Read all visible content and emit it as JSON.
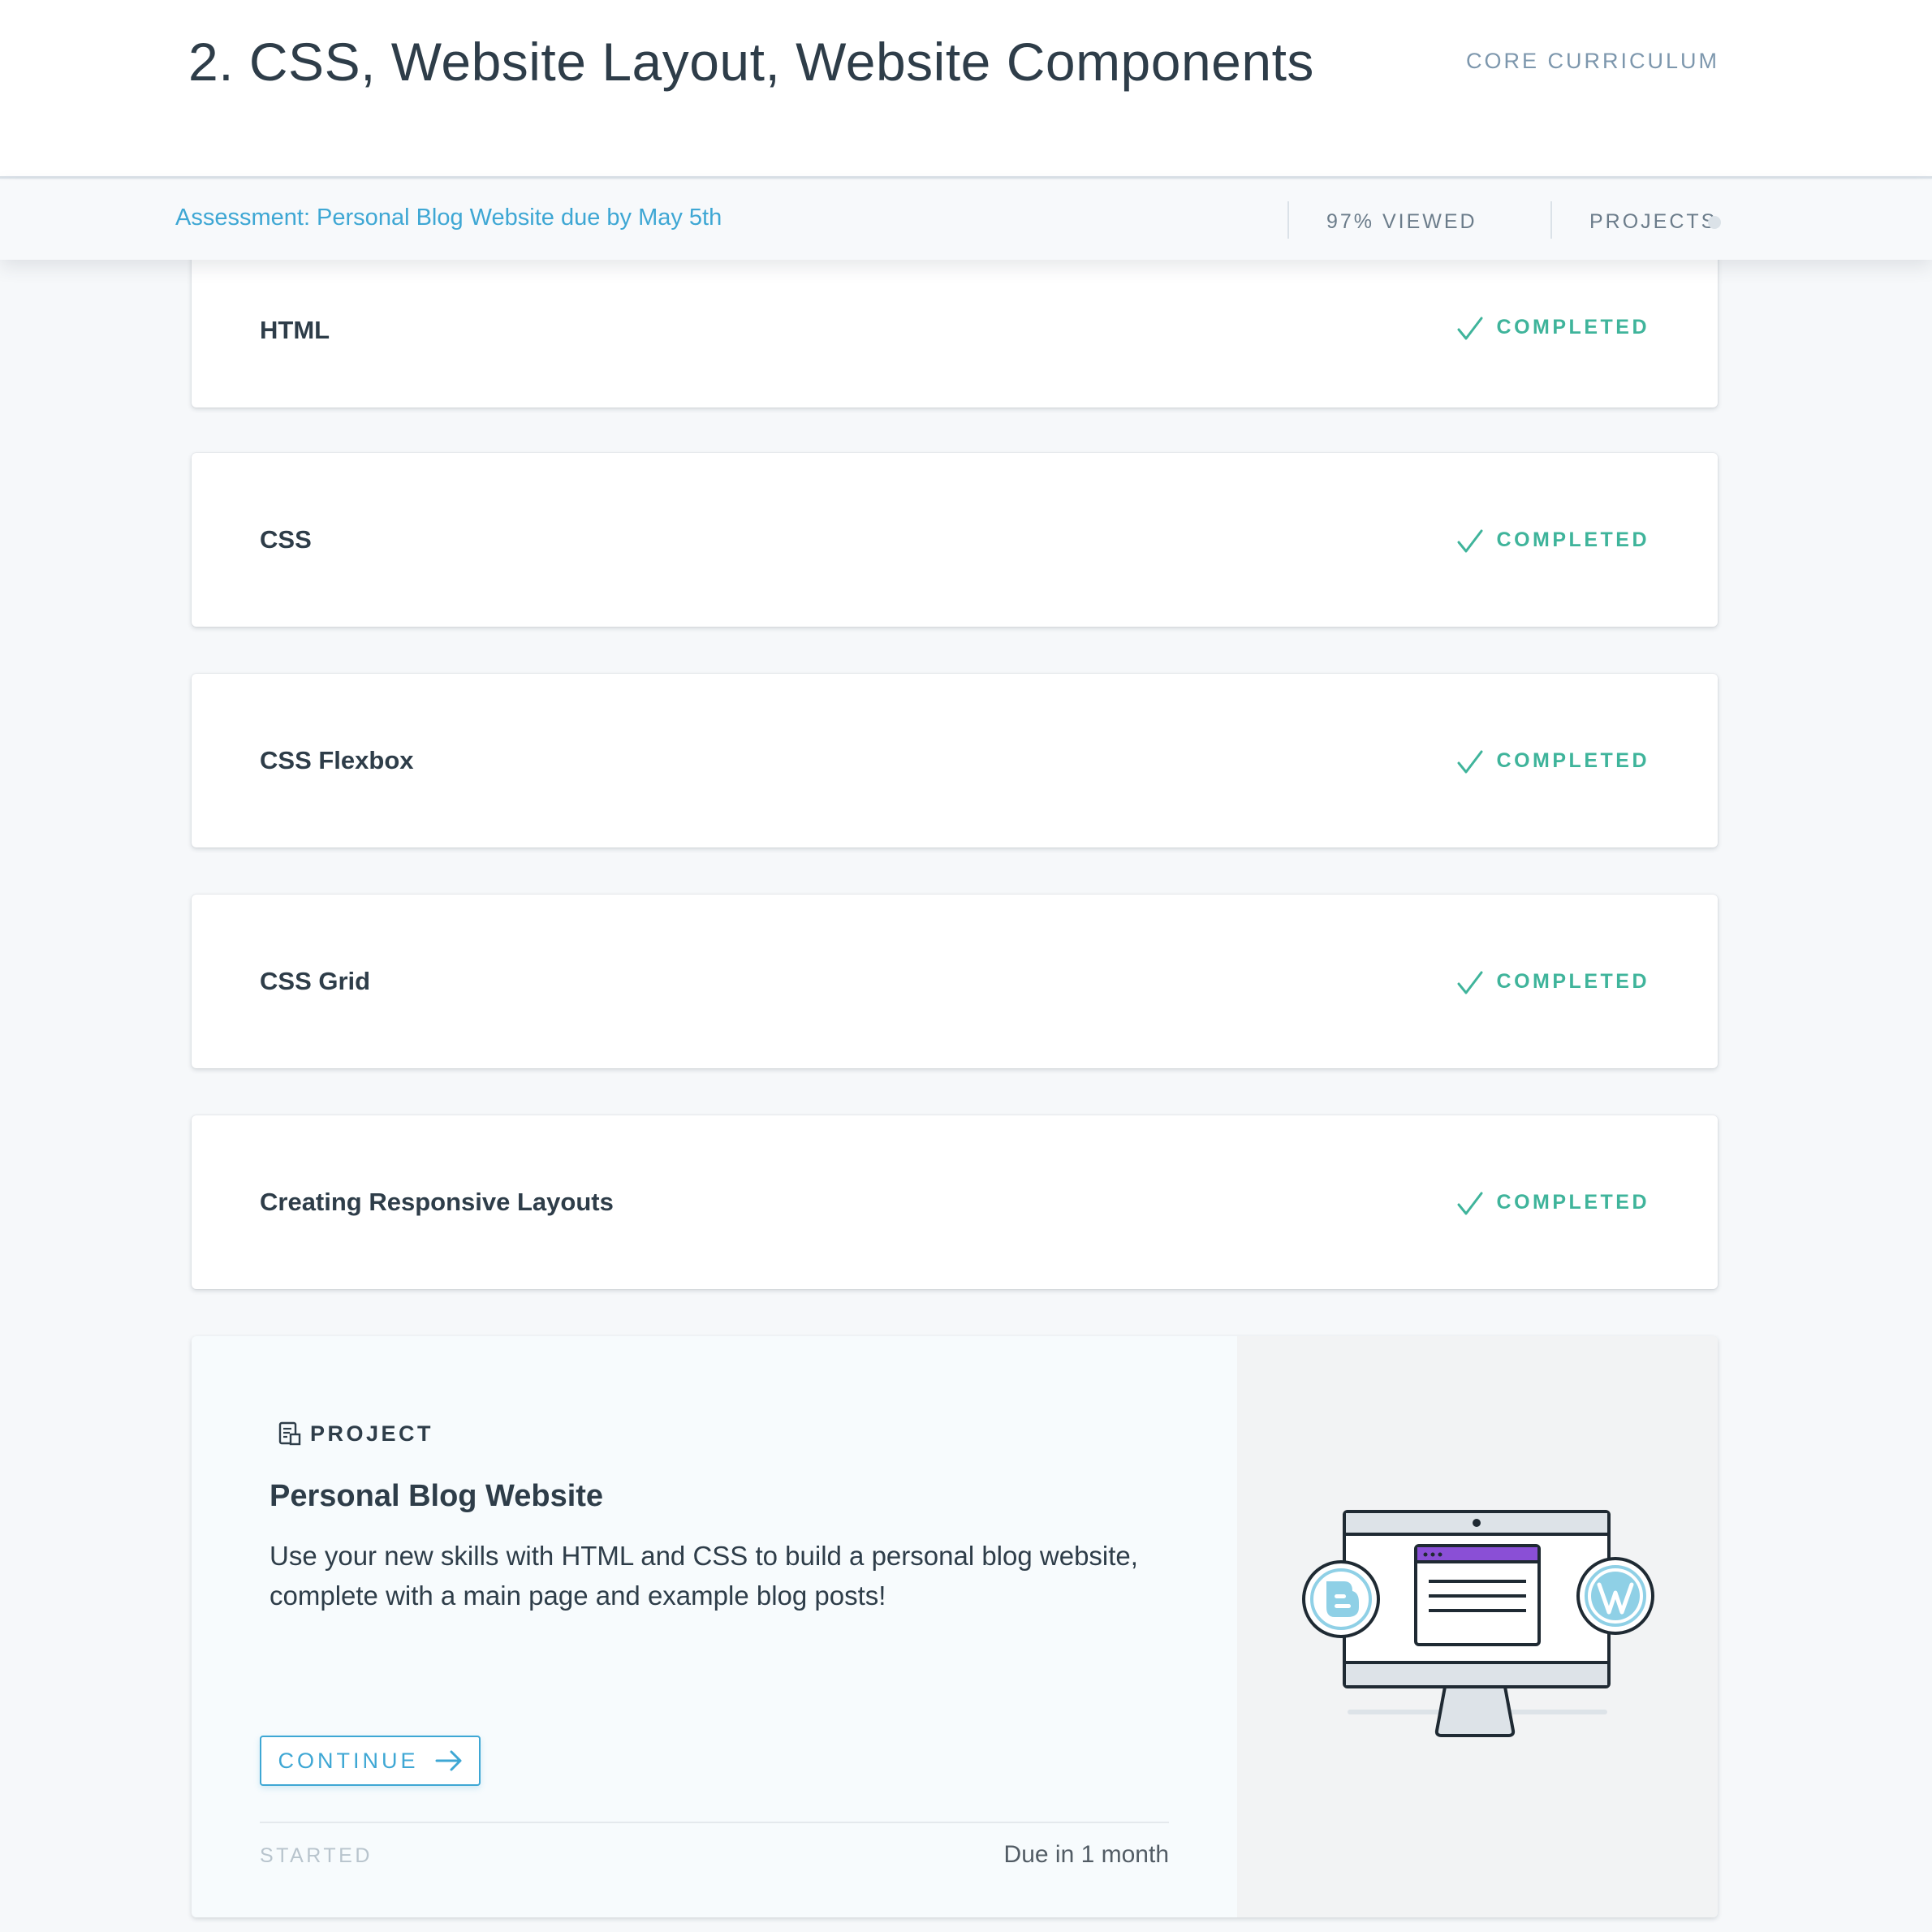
{
  "header": {
    "title": "2. CSS, Website Layout, Website Components",
    "curriculum_label": "CORE CURRICULUM"
  },
  "subbar": {
    "assessment_text": "Assessment: Personal Blog Website due by May 5th",
    "viewed_text": "97% VIEWED",
    "projects_label": "PROJECTS"
  },
  "lessons": [
    {
      "title": "HTML",
      "status": "COMPLETED"
    },
    {
      "title": "CSS",
      "status": "COMPLETED"
    },
    {
      "title": "CSS Flexbox",
      "status": "COMPLETED"
    },
    {
      "title": "CSS Grid",
      "status": "COMPLETED"
    },
    {
      "title": "Creating Responsive Layouts",
      "status": "COMPLETED"
    }
  ],
  "project": {
    "label": "PROJECT",
    "icon": "project-doc-icon",
    "title": "Personal Blog Website",
    "description": "Use your new skills with HTML and CSS to build a personal blog website, complete with a main page and example blog posts!",
    "button_label": "CONTINUE",
    "state_label": "STARTED",
    "due_text": "Due in 1 month",
    "illustration_icons": [
      "monitor-icon",
      "blogger-icon",
      "wordpress-icon"
    ]
  },
  "colors": {
    "accent": "#3ea7d4",
    "completed": "#3fb49b",
    "text": "#2e3d49",
    "muted": "#7d97ad"
  }
}
